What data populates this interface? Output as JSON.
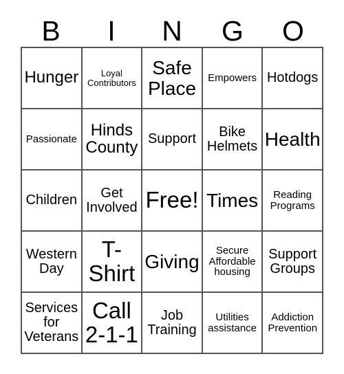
{
  "card": {
    "header_letters": [
      "B",
      "I",
      "N",
      "G",
      "O"
    ],
    "columns": 5,
    "rows": 5,
    "free_space_label": "Free!",
    "free_space_position": "center",
    "border_color": "#555555",
    "text_color": "#000000",
    "background_color": "#ffffff",
    "cells": [
      {
        "text": "Hunger",
        "size": "sz-l"
      },
      {
        "text": "Loyal\nContributors",
        "size": "sz-xs"
      },
      {
        "text": "Safe\nPlace",
        "size": "sz-xl"
      },
      {
        "text": "Empowers",
        "size": "sz-s"
      },
      {
        "text": "Hotdogs",
        "size": "sz-m"
      },
      {
        "text": "Passionate",
        "size": "sz-s"
      },
      {
        "text": "Hinds\nCounty",
        "size": "sz-l"
      },
      {
        "text": "Support",
        "size": "sz-m"
      },
      {
        "text": "Bike\nHelmets",
        "size": "sz-m"
      },
      {
        "text": "Health",
        "size": "sz-xl"
      },
      {
        "text": "Children",
        "size": "sz-m"
      },
      {
        "text": "Get\nInvolved",
        "size": "sz-m"
      },
      {
        "text": "Free!",
        "size": "sz-xxl"
      },
      {
        "text": "Times",
        "size": "sz-xl"
      },
      {
        "text": "Reading\nPrograms",
        "size": "sz-s"
      },
      {
        "text": "Western\nDay",
        "size": "sz-m"
      },
      {
        "text": "T-\nShirt",
        "size": "sz-xxl"
      },
      {
        "text": "Giving",
        "size": "sz-xl"
      },
      {
        "text": "Secure\nAffordable\nhousing",
        "size": "sz-s"
      },
      {
        "text": "Support\nGroups",
        "size": "sz-m"
      },
      {
        "text": "Services\nfor\nVeterans",
        "size": "sz-m"
      },
      {
        "text": "Call\n2-1-1",
        "size": "sz-xxl"
      },
      {
        "text": "Job\nTraining",
        "size": "sz-m"
      },
      {
        "text": "Utilities\nassistance",
        "size": "sz-s"
      },
      {
        "text": "Addiction\nPrevention",
        "size": "sz-s"
      }
    ]
  }
}
